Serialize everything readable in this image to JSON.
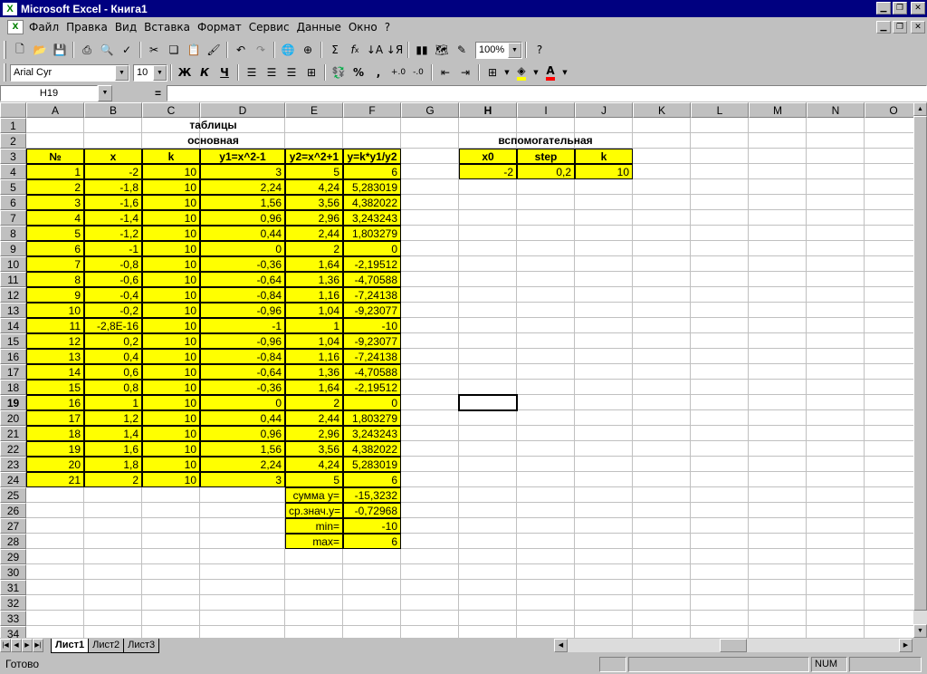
{
  "window": {
    "title": "Microsoft Excel - Книга1"
  },
  "menu": [
    "Файл",
    "Правка",
    "Вид",
    "Вставка",
    "Формат",
    "Сервис",
    "Данные",
    "Окно",
    "?"
  ],
  "toolbar": {
    "zoom": "100%",
    "font_name": "Arial Cyr",
    "font_size": "10",
    "bold": "Ж",
    "italic": "К",
    "underline": "Ч",
    "percent": "%",
    "comma": ",",
    "sum": "Σ",
    "fx": "f",
    "letter_a": "A"
  },
  "formula_bar": {
    "name_box": "H19",
    "equals": "=",
    "formula": ""
  },
  "columns": [
    "A",
    "B",
    "C",
    "D",
    "E",
    "F",
    "G",
    "H",
    "I",
    "J",
    "K",
    "L",
    "M",
    "N",
    "O"
  ],
  "rows": [
    "1",
    "2",
    "3",
    "4",
    "5",
    "6",
    "7",
    "8",
    "9",
    "10",
    "11",
    "12",
    "13",
    "14",
    "15",
    "16",
    "17",
    "18",
    "19",
    "20",
    "21",
    "22",
    "23",
    "24",
    "25",
    "26",
    "27",
    "28",
    "29",
    "30",
    "31",
    "32",
    "33",
    "34"
  ],
  "cells": {
    "title": "таблицы",
    "main_label": "основная",
    "aux_label": "вспомогательная",
    "headers": [
      "№",
      "x",
      "k",
      "y1=x^2-1",
      "y2=x^2+1",
      "y=k*y1/y2"
    ],
    "aux_headers": [
      "x0",
      "step",
      "k"
    ],
    "aux_values": [
      "-2",
      "0,2",
      "10"
    ],
    "data": [
      [
        "1",
        "-2",
        "10",
        "3",
        "5",
        "6"
      ],
      [
        "2",
        "-1,8",
        "10",
        "2,24",
        "4,24",
        "5,283019"
      ],
      [
        "3",
        "-1,6",
        "10",
        "1,56",
        "3,56",
        "4,382022"
      ],
      [
        "4",
        "-1,4",
        "10",
        "0,96",
        "2,96",
        "3,243243"
      ],
      [
        "5",
        "-1,2",
        "10",
        "0,44",
        "2,44",
        "1,803279"
      ],
      [
        "6",
        "-1",
        "10",
        "0",
        "2",
        "0"
      ],
      [
        "7",
        "-0,8",
        "10",
        "-0,36",
        "1,64",
        "-2,19512"
      ],
      [
        "8",
        "-0,6",
        "10",
        "-0,64",
        "1,36",
        "-4,70588"
      ],
      [
        "9",
        "-0,4",
        "10",
        "-0,84",
        "1,16",
        "-7,24138"
      ],
      [
        "10",
        "-0,2",
        "10",
        "-0,96",
        "1,04",
        "-9,23077"
      ],
      [
        "11",
        "-2,8E-16",
        "10",
        "-1",
        "1",
        "-10"
      ],
      [
        "12",
        "0,2",
        "10",
        "-0,96",
        "1,04",
        "-9,23077"
      ],
      [
        "13",
        "0,4",
        "10",
        "-0,84",
        "1,16",
        "-7,24138"
      ],
      [
        "14",
        "0,6",
        "10",
        "-0,64",
        "1,36",
        "-4,70588"
      ],
      [
        "15",
        "0,8",
        "10",
        "-0,36",
        "1,64",
        "-2,19512"
      ],
      [
        "16",
        "1",
        "10",
        "0",
        "2",
        "0"
      ],
      [
        "17",
        "1,2",
        "10",
        "0,44",
        "2,44",
        "1,803279"
      ],
      [
        "18",
        "1,4",
        "10",
        "0,96",
        "2,96",
        "3,243243"
      ],
      [
        "19",
        "1,6",
        "10",
        "1,56",
        "3,56",
        "4,382022"
      ],
      [
        "20",
        "1,8",
        "10",
        "2,24",
        "4,24",
        "5,283019"
      ],
      [
        "21",
        "2",
        "10",
        "3",
        "5",
        "6"
      ]
    ],
    "summary": [
      [
        "сумма y=",
        "-15,3232"
      ],
      [
        "ср.знач.y=",
        "-0,72968"
      ],
      [
        "min=",
        "-10"
      ],
      [
        "max=",
        "6"
      ]
    ]
  },
  "sheet_tabs": [
    "Лист1",
    "Лист2",
    "Лист3"
  ],
  "status": {
    "text": "Готово",
    "num": "NUM"
  }
}
